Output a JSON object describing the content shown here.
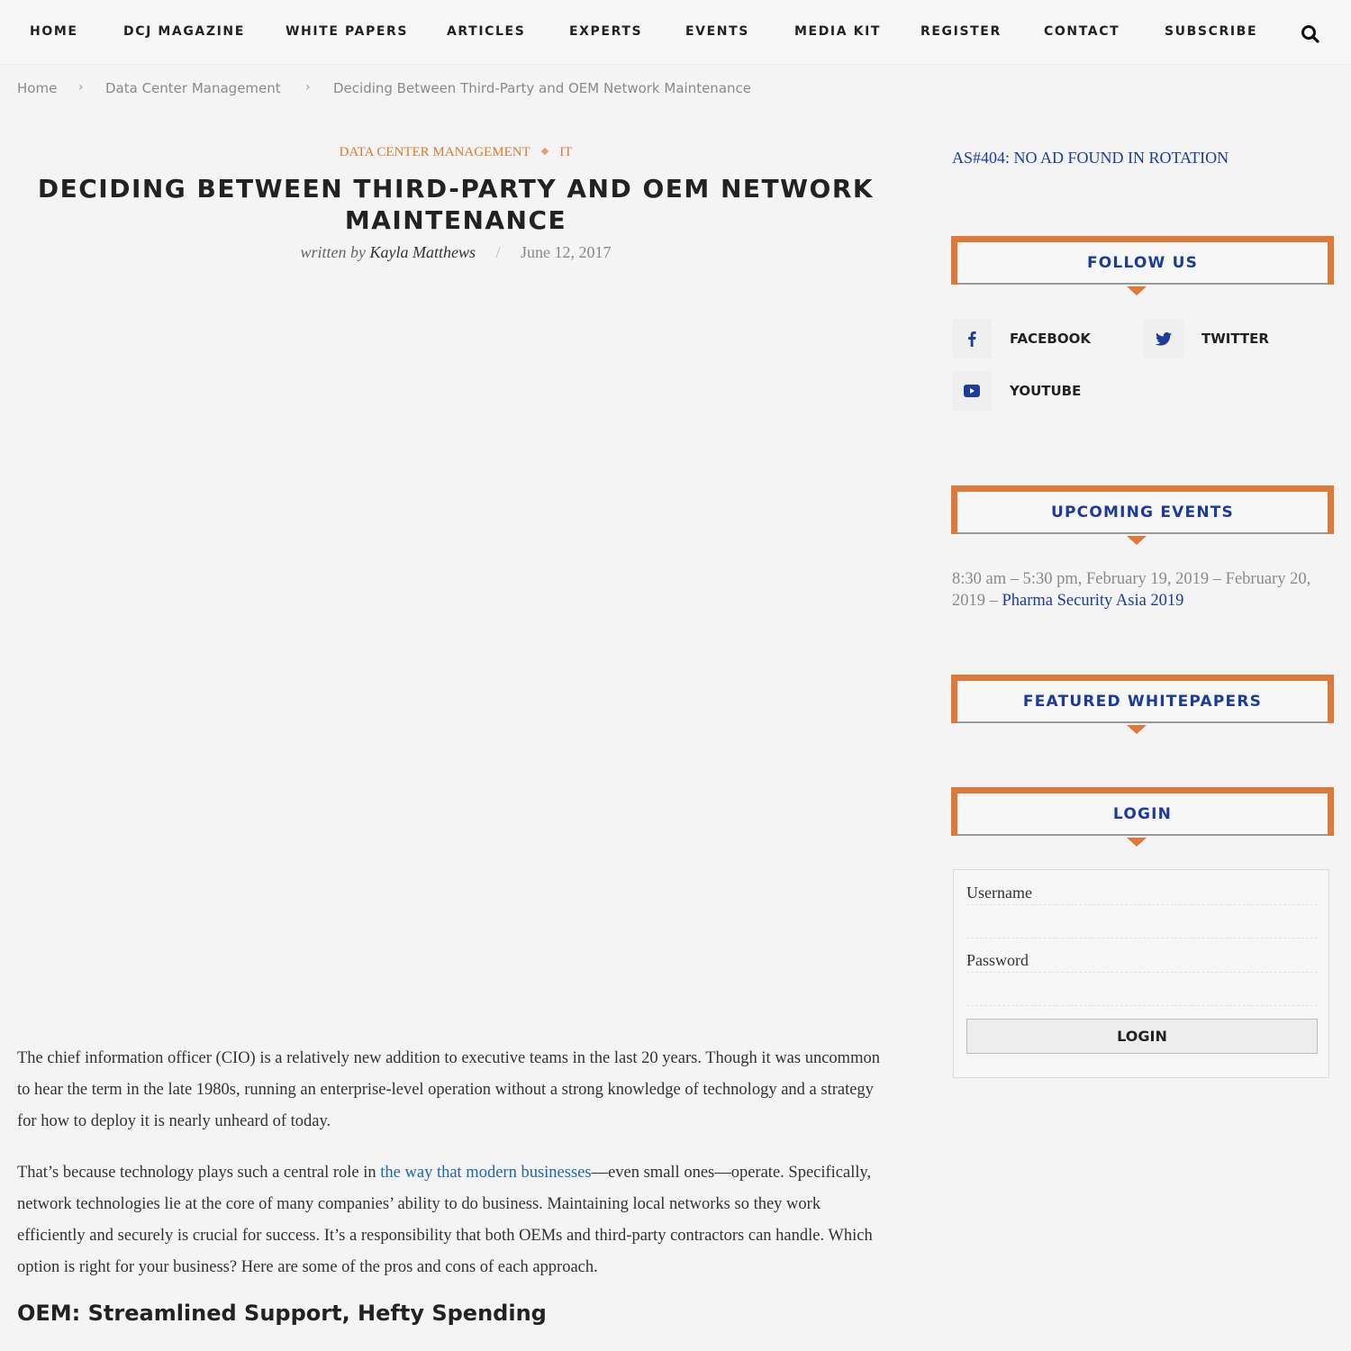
{
  "nav": {
    "items": [
      {
        "label": "HOME"
      },
      {
        "label": "DCJ MAGAZINE"
      },
      {
        "label": "WHITE PAPERS"
      },
      {
        "label": "ARTICLES"
      },
      {
        "label": "EXPERTS"
      },
      {
        "label": "EVENTS"
      },
      {
        "label": "MEDIA KIT"
      },
      {
        "label": "REGISTER"
      },
      {
        "label": "CONTACT"
      },
      {
        "label": "SUBSCRIBE"
      }
    ],
    "search_icon": "search-icon"
  },
  "breadcrumb": {
    "items": [
      "Home",
      "Data Center Management",
      "Deciding Between Third-Party and OEM Network Maintenance"
    ],
    "separator": "›"
  },
  "article": {
    "categories": [
      "DATA CENTER MANAGEMENT",
      "IT"
    ],
    "category_separator": "◆",
    "title": "DECIDING BETWEEN THIRD-PARTY AND OEM NETWORK MAINTENANCE",
    "byline_prefix": "written by",
    "author": "Kayla Matthews",
    "byline_separator": "/",
    "date": "June 12, 2017",
    "paragraphs": [
      {
        "text": "The chief information officer (CIO) is a relatively new addition to executive teams in the last 20 years. Though it was uncommon to hear the term in the late 1980s, running an enterprise-level operation without a strong knowledge of technology and a strategy for how to deploy it is nearly unheard of today."
      },
      {
        "before_link": "That’s because technology plays such a central role in ",
        "link": "the way that modern businesses",
        "after_link": "—even small ones—operate. Specifically, network technologies lie at the core of many companies’ ability to do business. Maintaining local networks so they work efficiently and securely is crucial for success. It’s a responsibility that both OEMs and third-party contractors can handle. Which option is right for your business? Here are some of the pros and cons of each approach."
      }
    ],
    "subheading": "OEM: Streamlined Support, Hefty Spending"
  },
  "sidebar": {
    "ad_notice": "AS#404: NO AD FOUND IN ROTATION",
    "follow_us": {
      "title": "FOLLOW US",
      "links": [
        {
          "label": "FACEBOOK",
          "icon": "facebook-icon"
        },
        {
          "label": "TWITTER",
          "icon": "twitter-icon"
        },
        {
          "label": "YOUTUBE",
          "icon": "youtube-icon"
        }
      ]
    },
    "upcoming_events": {
      "title": "UPCOMING EVENTS",
      "when": "8:30 am – 5:30 pm, February 19, 2019 – February 20, 2019 – ",
      "event_link": "Pharma Security Asia 2019"
    },
    "featured_whitepapers": {
      "title": "FEATURED WHITEPAPERS"
    },
    "login": {
      "title": "LOGIN",
      "username_label": "Username",
      "username_value": "",
      "password_label": "Password",
      "password_value": "",
      "button_label": "LOGIN"
    }
  },
  "colors": {
    "accent_orange": "#dd7a3a",
    "heading_blue": "#1d3c9a",
    "link_blue": "#2266b3",
    "category_orange": "#e07a34"
  }
}
